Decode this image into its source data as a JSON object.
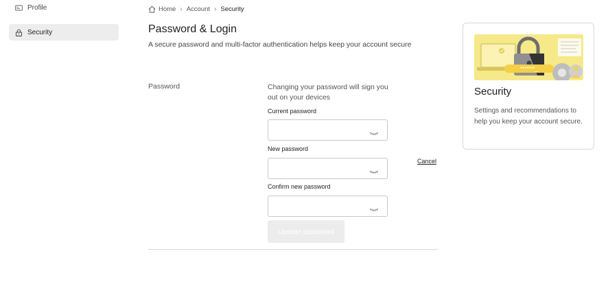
{
  "sidebar": {
    "items": [
      {
        "label": "Profile",
        "icon": "id-card-icon"
      },
      {
        "label": "Security",
        "icon": "lock-icon",
        "active": true
      }
    ]
  },
  "breadcrumb": {
    "items": [
      "Home",
      "Account",
      "Security"
    ]
  },
  "page": {
    "title": "Password & Login",
    "subtitle": "A secure password and multi-factor authentication helps keep your account secure"
  },
  "password_section": {
    "label": "Password",
    "warning": "Changing your password will sign you out on your devices",
    "fields": [
      {
        "label": "Current password",
        "value": "",
        "icon": "eye-closed-icon"
      },
      {
        "label": "New password",
        "value": "",
        "icon": "eye-closed-icon"
      },
      {
        "label": "Confirm new password",
        "value": "",
        "icon": "eye-closed-icon"
      }
    ],
    "cancel_label": "Cancel",
    "update_label": "Update password"
  },
  "card": {
    "title": "Security",
    "description": "Settings and recommendations to help you keep your account secure.",
    "illustration_password_mask": "*******_"
  },
  "colors": {
    "illustration_yellow": "#f6e98a",
    "active_nav_bg": "#ededed",
    "disabled_button_bg": "#ececec"
  }
}
